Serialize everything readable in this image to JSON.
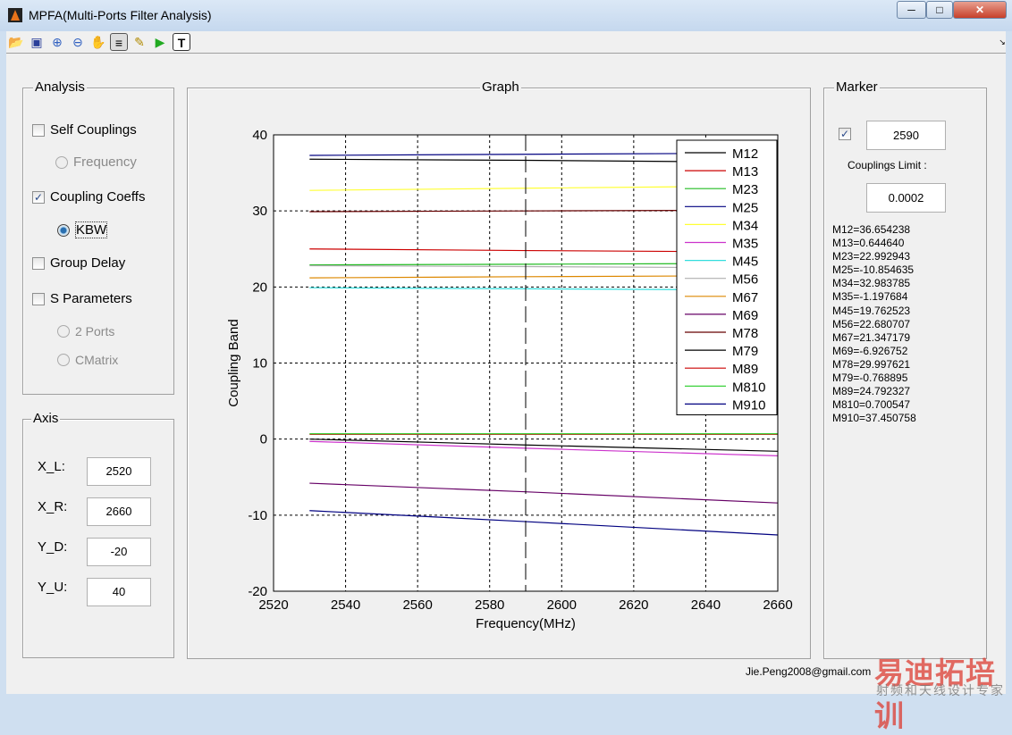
{
  "window": {
    "title": "MPFA(Multi-Ports Filter Analysis)",
    "buttons": [
      "minimize",
      "maximize",
      "close"
    ]
  },
  "toolbar": {
    "icons": [
      "open-folder-icon",
      "save-icon",
      "zoom-in-icon",
      "zoom-out-icon",
      "pan-hand-icon",
      "legend-icon",
      "data-cursor-icon",
      "run-icon",
      "text-icon"
    ],
    "text_button": "T"
  },
  "analysis": {
    "title": "Analysis",
    "self_couplings": {
      "label": "Self Couplings",
      "checked": false
    },
    "frequency": {
      "label": "Frequency",
      "selected": false
    },
    "coupling_coeffs": {
      "label": "Coupling Coeffs",
      "checked": true
    },
    "kbw": {
      "label": "KBW",
      "selected": true
    },
    "group_delay": {
      "label": "Group Delay",
      "checked": false
    },
    "s_parameters": {
      "label": "S Parameters",
      "checked": false
    },
    "two_ports": {
      "label": "2 Ports",
      "selected": false
    },
    "cmatrix": {
      "label": "CMatrix",
      "selected": false
    }
  },
  "axis": {
    "title": "Axis",
    "x_l_label": "X_L:",
    "x_l": "2520",
    "x_r_label": "X_R:",
    "x_r": "2660",
    "y_d_label": "Y_D:",
    "y_d": "-20",
    "y_u_label": "Y_U:",
    "y_u": "40"
  },
  "graph": {
    "title": "Graph"
  },
  "marker": {
    "title": "Marker",
    "enabled": true,
    "value": "2590",
    "limit_label": "Couplings Limit :",
    "limit": "0.0002",
    "readouts": [
      "M12=36.654238",
      "M13=0.644640",
      "M23=22.992943",
      "M25=-10.854635",
      "M34=32.983785",
      "M35=-1.197684",
      "M45=19.762523",
      "M56=22.680707",
      "M67=21.347179",
      "M69=-6.926752",
      "M78=29.997621",
      "M79=-0.768895",
      "M89=24.792327",
      "M810=0.700547",
      "M910=37.450758"
    ]
  },
  "footer": {
    "email": "Jie.Peng2008@gmail.com"
  },
  "watermark": {
    "line1": "易迪拓培训",
    "line2": "射频和天线设计专家"
  },
  "chart_data": {
    "type": "line",
    "xlabel": "Frequency(MHz)",
    "ylabel": "Coupling Band",
    "xlim": [
      2520,
      2660
    ],
    "ylim": [
      -20,
      40
    ],
    "xticks": [
      2520,
      2540,
      2560,
      2580,
      2600,
      2620,
      2640,
      2660
    ],
    "yticks": [
      -20,
      -10,
      0,
      10,
      20,
      30,
      40
    ],
    "grid": true,
    "legend_position": "top-right",
    "marker_x": 2590,
    "x": [
      2530,
      2590,
      2660
    ],
    "series": [
      {
        "name": "M12",
        "color": "#000000",
        "values": [
          36.8,
          36.65,
          36.4
        ]
      },
      {
        "name": "M13",
        "color": "#cc0000",
        "values": [
          0.64,
          0.64,
          0.64
        ]
      },
      {
        "name": "M23",
        "color": "#22bb22",
        "values": [
          22.9,
          22.99,
          23.1
        ]
      },
      {
        "name": "M25",
        "color": "#000080",
        "values": [
          -9.4,
          -10.85,
          -12.6
        ]
      },
      {
        "name": "M34",
        "color": "#ffff33",
        "values": [
          32.7,
          32.98,
          33.3
        ]
      },
      {
        "name": "M35",
        "color": "#cc33cc",
        "values": [
          -0.3,
          -1.2,
          -2.2
        ]
      },
      {
        "name": "M45",
        "color": "#33dddd",
        "values": [
          19.9,
          19.76,
          19.6
        ]
      },
      {
        "name": "M56",
        "color": "#b0b0b0",
        "values": [
          22.8,
          22.68,
          22.5
        ]
      },
      {
        "name": "M67",
        "color": "#dd8800",
        "values": [
          21.2,
          21.35,
          21.5
        ]
      },
      {
        "name": "M69",
        "color": "#660066",
        "values": [
          -5.8,
          -6.93,
          -8.4
        ]
      },
      {
        "name": "M78",
        "color": "#660000",
        "values": [
          29.9,
          30.0,
          30.1
        ]
      },
      {
        "name": "M79",
        "color": "#000000",
        "values": [
          0.0,
          -0.77,
          -1.6
        ]
      },
      {
        "name": "M89",
        "color": "#cc0000",
        "values": [
          25.0,
          24.79,
          24.6
        ]
      },
      {
        "name": "M810",
        "color": "#22cc22",
        "values": [
          0.7,
          0.7,
          0.7
        ]
      },
      {
        "name": "M910",
        "color": "#000080",
        "values": [
          37.3,
          37.45,
          37.6
        ]
      }
    ]
  }
}
